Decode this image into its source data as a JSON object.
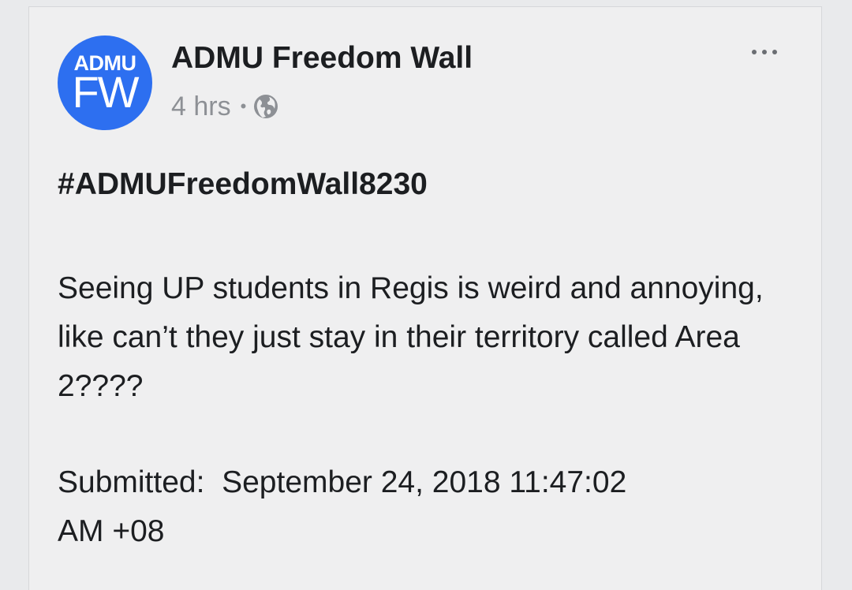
{
  "post": {
    "avatar": {
      "top_text": "ADMU",
      "bottom_text": "FW",
      "color": "#2d6ff0"
    },
    "page_name": "ADMU Freedom Wall",
    "time": "4 hrs",
    "separator": "•",
    "privacy_icon": "globe-icon",
    "more_icon": "more-options-icon",
    "hashtag": "#ADMUFreedomWall8230",
    "body": "Seeing UP students in Regis is weird and annoying, like can’t they just stay in their territory called Area 2????",
    "submitted_line1": "Submitted:  September 24, 2018 11:47:02",
    "submitted_line2": "AM +08"
  }
}
